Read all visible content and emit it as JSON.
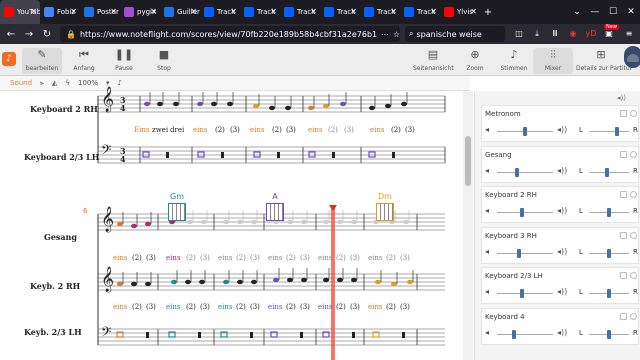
{
  "browser": {
    "tabs": [
      {
        "label": "YouTube",
        "color": "#ff0000",
        "active": true
      },
      {
        "label": "Fobiz",
        "color": "#4285f4"
      },
      {
        "label": "Poster",
        "color": "#1a73e8"
      },
      {
        "label": "pygix",
        "color": "#a24cd0"
      },
      {
        "label": "Guiller",
        "color": "#1a73e8"
      },
      {
        "label": "Track",
        "color": "#0061fe"
      },
      {
        "label": "Track",
        "color": "#0061fe"
      },
      {
        "label": "Track",
        "color": "#0061fe"
      },
      {
        "label": "Track",
        "color": "#0061fe"
      },
      {
        "label": "Track",
        "color": "#0061fe"
      },
      {
        "label": "Track",
        "color": "#0061fe"
      },
      {
        "label": "Ylvis",
        "color": "#ff0000"
      }
    ],
    "url": "https://www.noteflight.com/scores/view/70fb220e189b58b4cbf31a2e76b1",
    "search_value": "spanische weise",
    "new_badge": "New"
  },
  "toolbar": {
    "left": [
      {
        "label": "bearbeiten",
        "icon": "pencil-icon"
      },
      {
        "label": "Anfang",
        "icon": "skip-back-icon"
      },
      {
        "label": "Pause",
        "icon": "pause-icon"
      },
      {
        "label": "Stop",
        "icon": "stop-icon"
      }
    ],
    "right": [
      {
        "label": "Seitenansicht",
        "icon": "page-view-icon"
      },
      {
        "label": "Zoom",
        "icon": "zoom-icon"
      },
      {
        "label": "Stimmen",
        "icon": "guitar-icon"
      },
      {
        "label": "Mixer",
        "icon": "mixer-icon"
      },
      {
        "label": "Details zur Partitur",
        "icon": "details-icon"
      }
    ]
  },
  "subtoolbar": {
    "sound": "Sound",
    "zoom": "100%"
  },
  "score": {
    "systems": [
      {
        "instruments": [
          "Keyboard 2 RH",
          "Keyboard 2/3 LH"
        ],
        "time_signature": [
          "3",
          "4"
        ]
      },
      {
        "instruments": [
          "Gesang",
          "Keyb. 2 RH",
          "Keyb. 2/3 LH"
        ],
        "measure_number": "6"
      }
    ],
    "lyrics_row1": [
      {
        "text": "Eins",
        "color": "#e07a22"
      },
      {
        "text": "zwei",
        "color": "#222"
      },
      {
        "text": "drei",
        "color": "#222"
      },
      {
        "text": "eins",
        "color": "#e07a22"
      },
      {
        "text": "(2)",
        "color": "#222"
      },
      {
        "text": "(3)",
        "color": "#222"
      },
      {
        "text": "eins",
        "color": "#e07a22"
      },
      {
        "text": "(2)",
        "color": "#222"
      },
      {
        "text": "(3)",
        "color": "#222"
      },
      {
        "text": "eins",
        "color": "#e07a22"
      },
      {
        "text": "(2)",
        "color": "#888"
      },
      {
        "text": "(3)",
        "color": "#888"
      },
      {
        "text": "eins",
        "color": "#e07a22"
      },
      {
        "text": "(2)",
        "color": "#222"
      },
      {
        "text": "(3)",
        "color": "#222"
      }
    ],
    "lyrics_gesang": [
      {
        "text": "eins",
        "color": "#e07a22"
      },
      {
        "text": "(2)",
        "color": "#222"
      },
      {
        "text": "(3)",
        "color": "#222"
      },
      {
        "text": "eins",
        "color": "#b5256a"
      },
      {
        "text": "(2)",
        "color": "#888"
      },
      {
        "text": "(3)",
        "color": "#888"
      },
      {
        "text": "eins",
        "color": "#888"
      },
      {
        "text": "(2)",
        "color": "#888"
      },
      {
        "text": "(3)",
        "color": "#888"
      },
      {
        "text": "eins",
        "color": "#888"
      },
      {
        "text": "(2)",
        "color": "#888"
      },
      {
        "text": "(3)",
        "color": "#888"
      },
      {
        "text": "eins",
        "color": "#888"
      },
      {
        "text": "(2)",
        "color": "#888"
      },
      {
        "text": "(3)",
        "color": "#888"
      },
      {
        "text": "eins",
        "color": "#888"
      },
      {
        "text": "(2)",
        "color": "#888"
      },
      {
        "text": "(3)",
        "color": "#888"
      }
    ],
    "lyrics_keyb": [
      {
        "text": "eins",
        "color": "#e07a22"
      },
      {
        "text": "(2)",
        "color": "#222"
      },
      {
        "text": "(3)",
        "color": "#222"
      },
      {
        "text": "eins",
        "color": "#1a8c8c"
      },
      {
        "text": "(2)",
        "color": "#222"
      },
      {
        "text": "(3)",
        "color": "#222"
      },
      {
        "text": "eins",
        "color": "#1a8c8c"
      },
      {
        "text": "(2)",
        "color": "#222"
      },
      {
        "text": "(3)",
        "color": "#222"
      },
      {
        "text": "eins",
        "color": "#6a4bc4"
      },
      {
        "text": "(2)",
        "color": "#222"
      },
      {
        "text": "(3)",
        "color": "#222"
      },
      {
        "text": "eins",
        "color": "#6a4bc4"
      },
      {
        "text": "(2)",
        "color": "#222"
      },
      {
        "text": "(3)",
        "color": "#222"
      },
      {
        "text": "eins",
        "color": "#e07a22"
      },
      {
        "text": "(2)",
        "color": "#222"
      },
      {
        "text": "(3)",
        "color": "#222"
      }
    ],
    "chords": [
      {
        "name": "Gm",
        "color": "#1a8c8c"
      },
      {
        "name": "A",
        "color": "#6a4bc4"
      },
      {
        "name": "Dm",
        "color": "#d9a11a"
      }
    ]
  },
  "mixer": {
    "channels": [
      {
        "name": "Metronom",
        "volume": 0.5,
        "pan": 0.7
      },
      {
        "name": "Gesang",
        "volume": 0.35,
        "pan": 0.45
      },
      {
        "name": "Keyboard 2 RH",
        "volume": 0.45,
        "pan": 0.5
      },
      {
        "name": "Keyboard 3 RH",
        "volume": 0.4,
        "pan": 0.5
      },
      {
        "name": "Keyboard 2/3 LH",
        "volume": 0.45,
        "pan": 0.5
      },
      {
        "name": "Keyboard 4",
        "volume": 0.3,
        "pan": 0.5
      }
    ],
    "labels": {
      "left": "L",
      "right": "R"
    }
  }
}
